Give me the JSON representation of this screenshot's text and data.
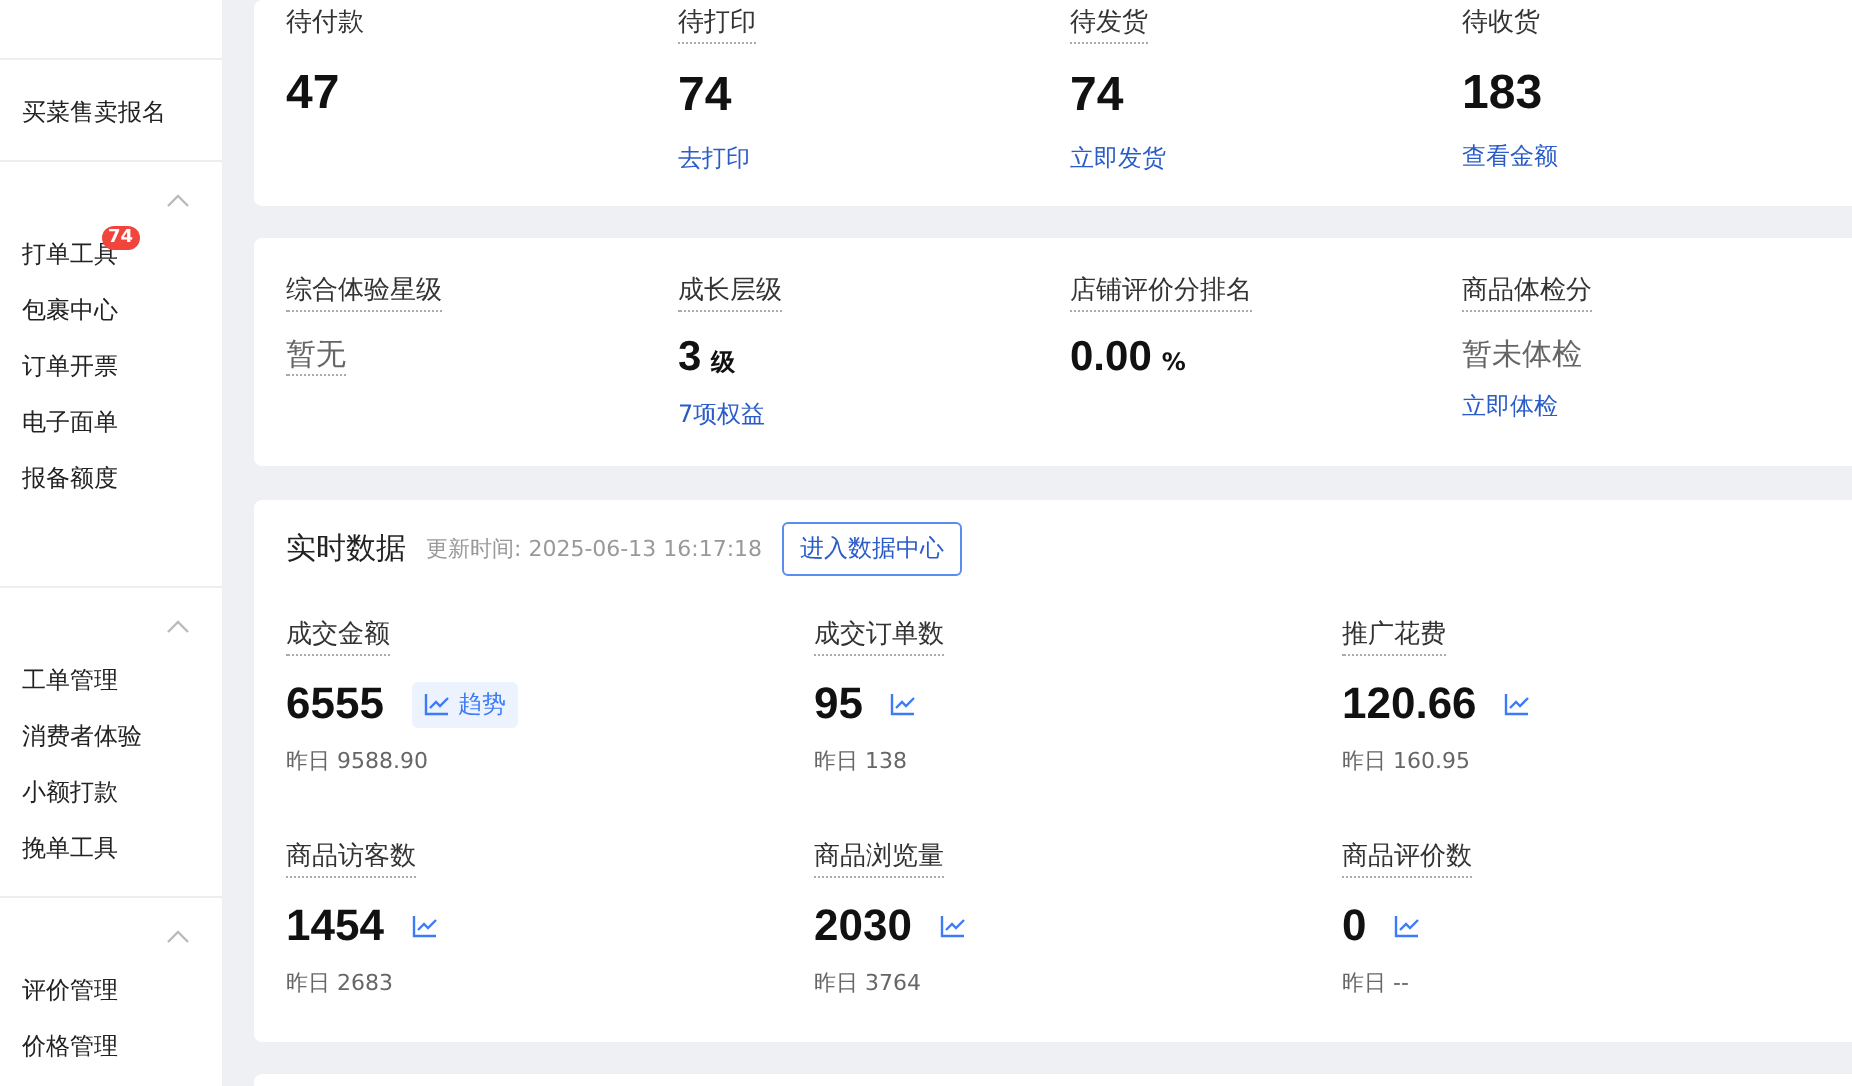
{
  "sidebar": {
    "groups": [
      {
        "kind": "plain",
        "items": [
          {
            "label": "买菜售卖报名"
          }
        ]
      },
      {
        "kind": "collapsible",
        "expanded": true,
        "items": [
          {
            "label": "打单工具",
            "badge": "74"
          },
          {
            "label": "包裹中心"
          },
          {
            "label": "订单开票"
          },
          {
            "label": "电子面单"
          },
          {
            "label": "报备额度"
          }
        ]
      },
      {
        "kind": "collapsible",
        "expanded": true,
        "items": [
          {
            "label": "工单管理"
          },
          {
            "label": "消费者体验"
          },
          {
            "label": "小额打款"
          },
          {
            "label": "挽单工具"
          }
        ]
      },
      {
        "kind": "collapsible",
        "expanded": true,
        "items": [
          {
            "label": "评价管理"
          },
          {
            "label": "价格管理"
          }
        ]
      }
    ]
  },
  "orders": [
    {
      "label": "待付款",
      "hint": false,
      "value": "47"
    },
    {
      "label": "待打印",
      "hint": true,
      "value": "74",
      "link": "去打印"
    },
    {
      "label": "待发货",
      "hint": true,
      "value": "74",
      "link": "立即发货"
    },
    {
      "label": "待收货",
      "hint": false,
      "value": "183",
      "link": "查看金额"
    }
  ],
  "ratings": [
    {
      "label": "综合体验星级",
      "kind": "muted",
      "value": "暂无",
      "value_hint": true
    },
    {
      "label": "成长层级",
      "kind": "number",
      "value": "3",
      "unit": "级",
      "link": "7项权益"
    },
    {
      "label": "店铺评价分排名",
      "kind": "number",
      "value": "0.00",
      "unit": "%"
    },
    {
      "label": "商品体检分",
      "kind": "muted",
      "value": "暂未体检",
      "value_hint": false,
      "link": "立即体检"
    }
  ],
  "realtime": {
    "title": "实时数据",
    "updated": "更新时间: 2025-06-13 16:17:18",
    "button": "进入数据中心",
    "metrics": [
      {
        "label": "成交金额",
        "value": "6555",
        "trend_label": "趋势",
        "yesterday": "昨日 9588.90"
      },
      {
        "label": "成交订单数",
        "value": "95",
        "yesterday": "昨日 138"
      },
      {
        "label": "推广花费",
        "value": "120.66",
        "yesterday": "昨日 160.95"
      },
      {
        "label": "商品访客数",
        "value": "1454",
        "yesterday": "昨日 2683"
      },
      {
        "label": "商品浏览量",
        "value": "2030",
        "yesterday": "昨日 3764"
      },
      {
        "label": "商品评价数",
        "value": "0",
        "yesterday": "昨日 --"
      }
    ]
  }
}
